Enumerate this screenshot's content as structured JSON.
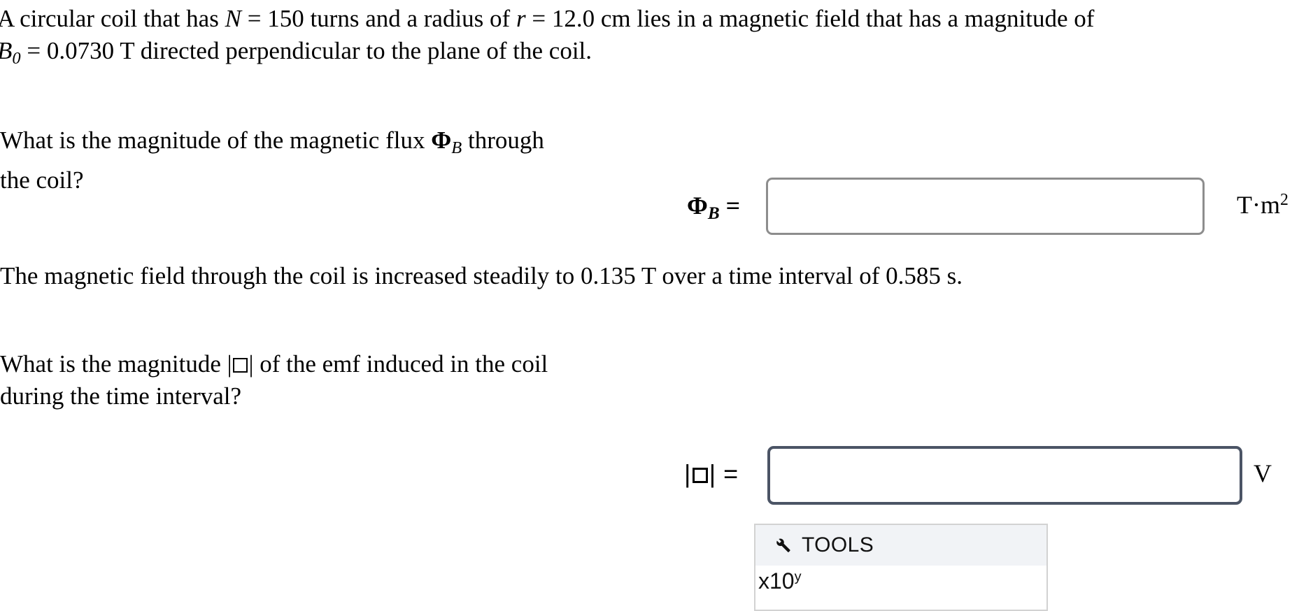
{
  "problem": {
    "statement_intro": {
      "line1_pre": "A circular coil that has ",
      "var_N": "N",
      "line1_mid1": " = 150 turns and a radius of ",
      "var_r": "r",
      "line1_mid2": " = 12.0 cm lies in a magnetic field that has a magnitude of",
      "var_B": "B",
      "sub_0": "0",
      "line2_rest": " = 0.0730 T directed perpendicular to the plane of the coil."
    },
    "question1": {
      "line1_pre": "What is the magnitude of the magnetic flux ",
      "symbol": "Φ",
      "symbol_sub": "B",
      "line1_post": " through",
      "line2": "the coil?"
    },
    "statement_mid": {
      "line1": "The magnetic field through the coil is increased steadily to 0.135 T over a time interval of 0.585 s."
    },
    "question2": {
      "line1_pre": "What is the magnitude |",
      "line1_post": "| of the emf induced in the coil",
      "line2": "during the time interval?"
    }
  },
  "answers": [
    {
      "id": "flux",
      "label_symbol": "Φ",
      "label_sub": "B",
      "label_equals": " =",
      "value": "",
      "placeholder": "",
      "unit_main": "T·m",
      "unit_sup": "2",
      "border_color": "#8d8d8d",
      "focused": false
    },
    {
      "id": "emf",
      "label_prefix": "|",
      "label_suffix": "|",
      "label_equals": " =",
      "value": "",
      "placeholder": "",
      "unit_main": "V",
      "unit_sup": "",
      "border_color": "#4b5465",
      "focused": true
    }
  ],
  "tools_panel": {
    "icon": "wrench-icon",
    "title": "TOOLS",
    "items": [
      {
        "label_main": "x10",
        "label_sup": "y"
      }
    ],
    "header_background": "#f1f3f6",
    "border_color": "#d2d2d2"
  }
}
